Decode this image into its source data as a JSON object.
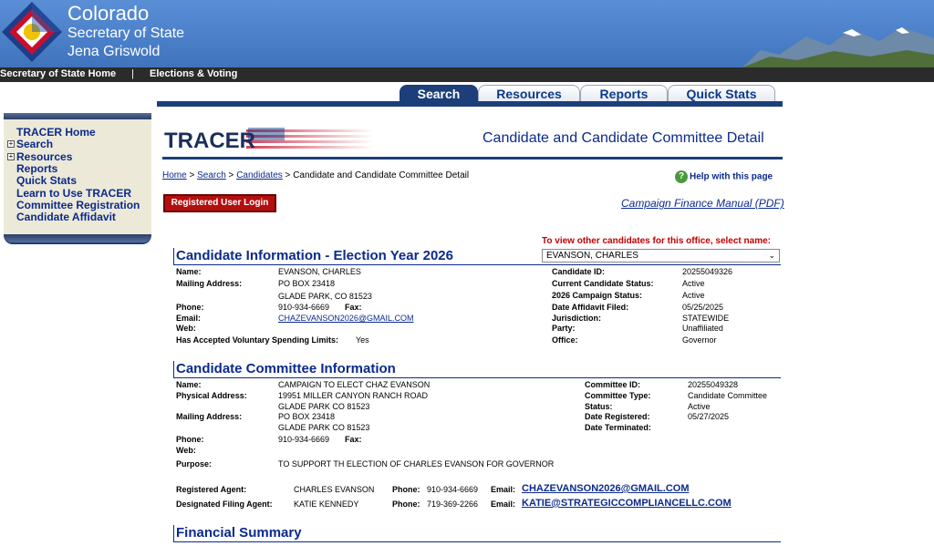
{
  "header": {
    "line1": "Colorado",
    "line2": "Secretary of State",
    "line3": "Jena Griswold"
  },
  "topnav": {
    "home": "Secretary of State Home",
    "separator": "|",
    "elections": "Elections & Voting"
  },
  "tabs": [
    "Search",
    "Resources",
    "Reports",
    "Quick Stats"
  ],
  "leftnav": {
    "items": [
      "TRACER Home",
      "Search",
      "Resources",
      "Reports",
      "Quick Stats",
      "Learn to Use TRACER",
      "Committee Registration",
      "Candidate Affidavit"
    ]
  },
  "main": {
    "logo_text": "TRACER",
    "title": "Candidate and Candidate Committee Detail",
    "breadcrumb": {
      "home": "Home",
      "sep": " > ",
      "search": "Search",
      "candidates": "Candidates",
      "current": "Candidate and Candidate Committee Detail"
    },
    "help": "Help with this page",
    "help_icon": "?",
    "login_button": "Registered User Login",
    "finance_manual": "Campaign Finance Manual (PDF)",
    "other_candidates_prompt": "To view other candidates for this office, select name:",
    "candidate_select": "EVANSON, CHARLES"
  },
  "candidate": {
    "section_title": "Candidate Information - Election Year 2026",
    "name_label": "Name:",
    "name": "EVANSON, CHARLES",
    "mailing_label": "Mailing Address:",
    "mailing1": "PO BOX 23418",
    "mailing2": "GLADE PARK, CO 81523",
    "phone_label": "Phone:",
    "phone": "910-934-6669",
    "fax_label": "Fax:",
    "email_label": "Email:",
    "email": "CHAZEVANSON2026@GMAIL.COM",
    "web_label": "Web:",
    "vsl_label": "Has Accepted Voluntary Spending Limits:",
    "vsl": "Yes",
    "id_label": "Candidate ID:",
    "id": "20255049326",
    "status_label": "Current Candidate Status:",
    "status": "Active",
    "campaign_status_label": "2026 Campaign Status:",
    "campaign_status": "Active",
    "affidavit_label": "Date Affidavit Filed:",
    "affidavit": "05/25/2025",
    "jurisdiction_label": "Jurisdiction:",
    "jurisdiction": "STATEWIDE",
    "party_label": "Party:",
    "party": "Unaffiliated",
    "office_label": "Office:",
    "office": "Governor"
  },
  "committee": {
    "section_title": "Candidate Committee Information",
    "name_label": "Name:",
    "name": "CAMPAIGN TO ELECT CHAZ EVANSON",
    "physical_label": "Physical Address:",
    "physical1": "19951 MILLER CANYON RANCH ROAD",
    "physical2": "GLADE PARK CO 81523",
    "mailing_label": "Mailing Address:",
    "mailing1": "PO BOX 23418",
    "mailing2": "GLADE PARK CO 81523",
    "phone_label": "Phone:",
    "phone": "910-934-6669",
    "fax_label": "Fax:",
    "web_label": "Web:",
    "purpose_label": "Purpose:",
    "purpose": "TO SUPPORT TH ELECTION OF CHARLES EVANSON FOR GOVERNOR",
    "id_label": "Committee ID:",
    "id": "20255049328",
    "type_label": "Committee Type:",
    "type": "Candidate Committee",
    "status_label": "Status:",
    "status": "Active",
    "registered_label": "Date Registered:",
    "registered": "05/27/2025",
    "terminated_label": "Date Terminated:",
    "agent_label": "Registered Agent:",
    "agent_name": "CHARLES EVANSON",
    "agent_phone_label": "Phone:",
    "agent_phone": "910-934-6669",
    "agent_email_label": "Email:",
    "agent_email": "CHAZEVANSON2026@GMAIL.COM",
    "dfa_label": "Designated Filing Agent:",
    "dfa_name": "KATIE KENNEDY",
    "dfa_phone_label": "Phone:",
    "dfa_phone": "719-369-2266",
    "dfa_email_label": "Email:",
    "dfa_email": "KATIE@STRATEGICCOMPLIANCELLC.COM"
  },
  "financial": {
    "section_title": "Financial Summary"
  },
  "colors": {
    "navy": "#1c3f7a",
    "link": "#0b2a8c",
    "alert": "#c00000",
    "login": "#b20f0f"
  }
}
